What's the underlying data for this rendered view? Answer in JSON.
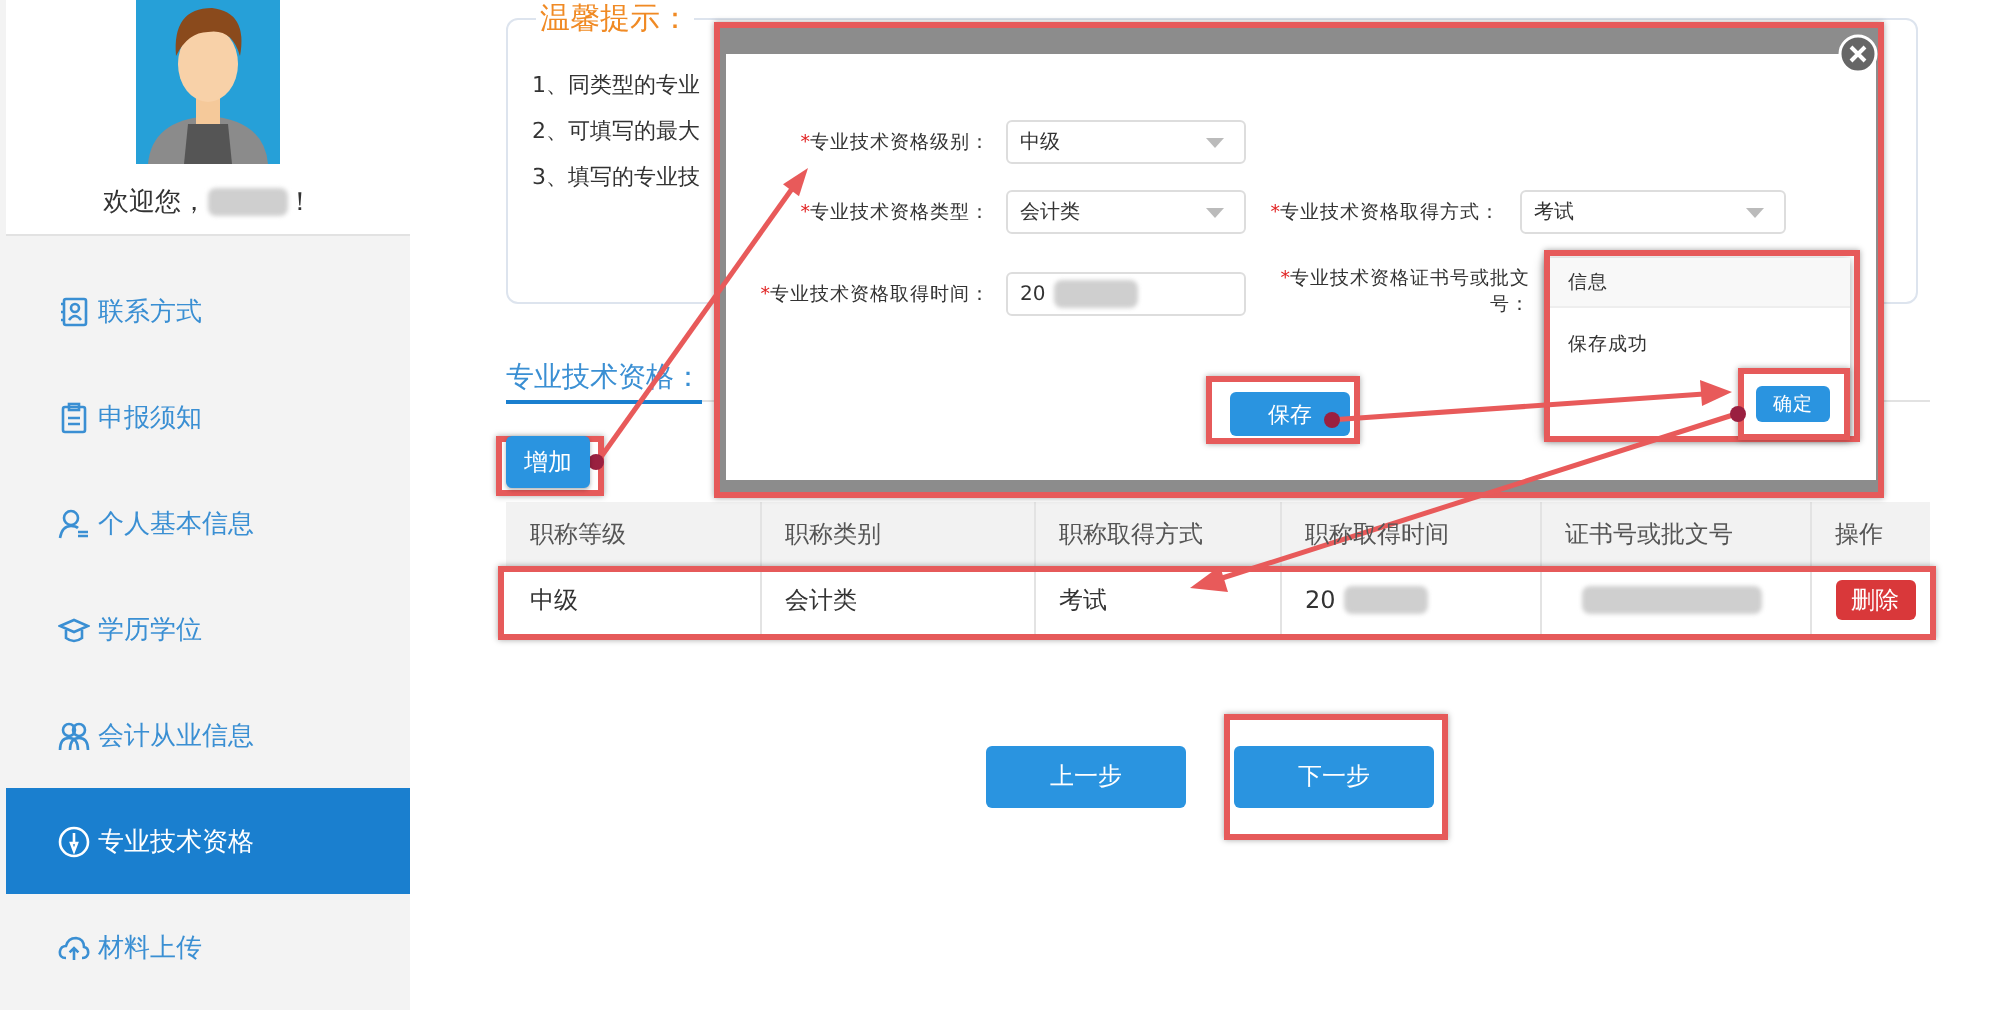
{
  "sidebar": {
    "welcome_prefix": "欢迎您，",
    "name_redacted": true,
    "welcome_suffix": "！",
    "items": [
      {
        "label": "联系方式",
        "kind": "contact",
        "selected": false
      },
      {
        "label": "申报须知",
        "kind": "notice",
        "selected": false
      },
      {
        "label": "个人基本信息",
        "kind": "person",
        "selected": false
      },
      {
        "label": "学历学位",
        "kind": "education",
        "selected": false
      },
      {
        "label": "会计从业信息",
        "kind": "group",
        "selected": false
      },
      {
        "label": "专业技术资格",
        "kind": "certificate",
        "selected": true
      },
      {
        "label": "材料上传",
        "kind": "upload",
        "selected": false
      }
    ]
  },
  "tips": {
    "title": "温馨提示：",
    "lines": [
      "1、同类型的专业",
      "2、可填写的最大",
      "3、填写的专业技"
    ]
  },
  "section_title": "专业技术资格：",
  "add_button": "增加",
  "table": {
    "columns": [
      "职称等级",
      "职称类别",
      "职称取得方式",
      "职称取得时间",
      "证书号或批文号",
      "操作"
    ],
    "rows": [
      {
        "cells": [
          {
            "text": "中级"
          },
          {
            "text": "会计类"
          },
          {
            "text": "考试"
          },
          {
            "text": "20",
            "redacted": true
          },
          {
            "redacted": true
          }
        ],
        "action": "删除"
      }
    ]
  },
  "buttons": [
    "上一步",
    "下一步"
  ],
  "modal": {
    "fields": [
      {
        "mark": "*",
        "label": "专业技术资格级别：",
        "kind": "select",
        "value": "中级"
      },
      {
        "mark": "*",
        "label": "专业技术资格类型：",
        "kind": "select",
        "value": "会计类"
      },
      {
        "mark": "*",
        "label": "专业技术资格取得方式：",
        "kind": "select",
        "value": "考试"
      },
      {
        "mark": "*",
        "label": "专业技术资格取得时间：",
        "kind": "text",
        "value": "20",
        "redacted": true
      },
      {
        "mark": "*",
        "label": "专业技术资格证书号或批文号：",
        "kind": "hidden"
      }
    ],
    "save_button": "保存",
    "message": {
      "title": "信息",
      "text": "保存成功",
      "ok": "确定"
    }
  }
}
